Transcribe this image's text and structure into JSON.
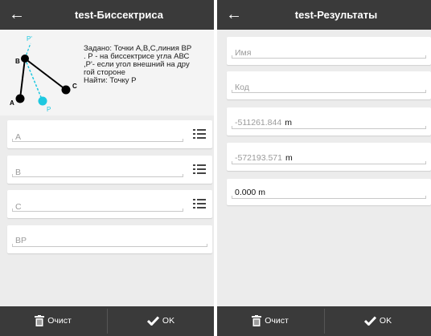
{
  "colors": {
    "bar": "#3a3a3a",
    "background": "#ececec",
    "field": "#ffffff",
    "diagram_point": "#000000",
    "diagram_P": "#1ec8e0"
  },
  "left": {
    "title": "test-Биссектриса",
    "description": [
      "Задано: Точки А,В,С,линия ВР",
      ". Р - на биссектрисе угла АВС",
      ",Р'- если угол внешний на дру",
      "гой стороне",
      "Найти: Точку Р"
    ],
    "diagram_labels": {
      "B": "B",
      "A": "A",
      "C": "C",
      "P": "P",
      "P_prime": "P'"
    },
    "fields": [
      {
        "placeholder": "A",
        "icon": "list-icon"
      },
      {
        "placeholder": "B",
        "icon": "list-icon"
      },
      {
        "placeholder": "C",
        "icon": "list-icon"
      },
      {
        "placeholder": "BP"
      }
    ],
    "bottom": {
      "clear_label": "Очист",
      "ok_label": "OK"
    }
  },
  "right": {
    "title": "test-Результаты",
    "fields": [
      {
        "placeholder": "Имя"
      },
      {
        "placeholder": "Код"
      },
      {
        "value": "-511261.844",
        "unit": "m"
      },
      {
        "value": "-572193.571",
        "unit": "m"
      },
      {
        "value": "0.000 m"
      }
    ],
    "bottom": {
      "clear_label": "Очист",
      "ok_label": "OK"
    }
  }
}
